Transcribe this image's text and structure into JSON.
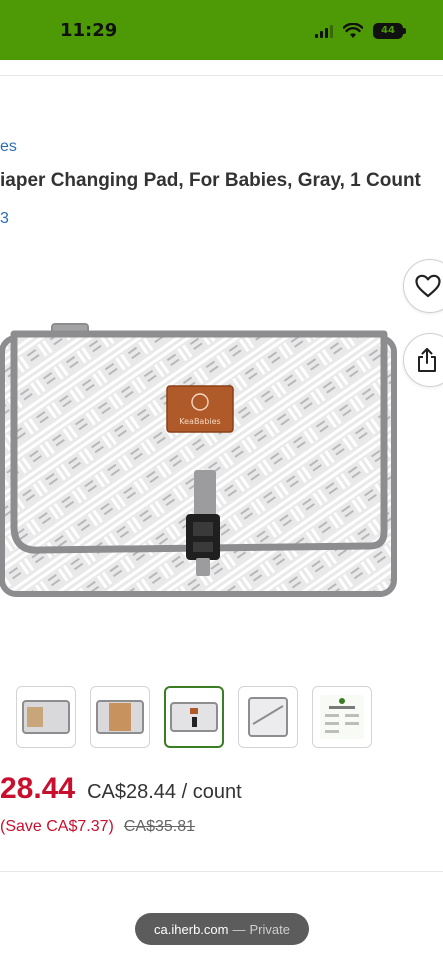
{
  "status_bar": {
    "time": "11:29",
    "battery": "44",
    "background": "#4e9a06"
  },
  "product": {
    "breadcrumb_fragment": "es",
    "title": "iaper Changing Pad, For Babies, Gray, 1 Count",
    "rating_fragment": "3",
    "brand_patch_text": "KeaBabies",
    "thumbnail_count": 5,
    "selected_thumbnail_index": 2
  },
  "actions": {
    "wishlist_icon": "heart-icon",
    "share_icon": "share-icon"
  },
  "pricing": {
    "price_fragment": "28.44",
    "unit_price": "CA$28.44 / count",
    "savings": "(Save CA$7.37)",
    "original_price": "CA$35.81",
    "price_color": "#c8102e"
  },
  "browser": {
    "url": "ca.iherb.com",
    "separator": "—",
    "mode": "Private"
  },
  "colors": {
    "accent_green": "#3b7d23",
    "link_blue": "#2a6fb4"
  }
}
